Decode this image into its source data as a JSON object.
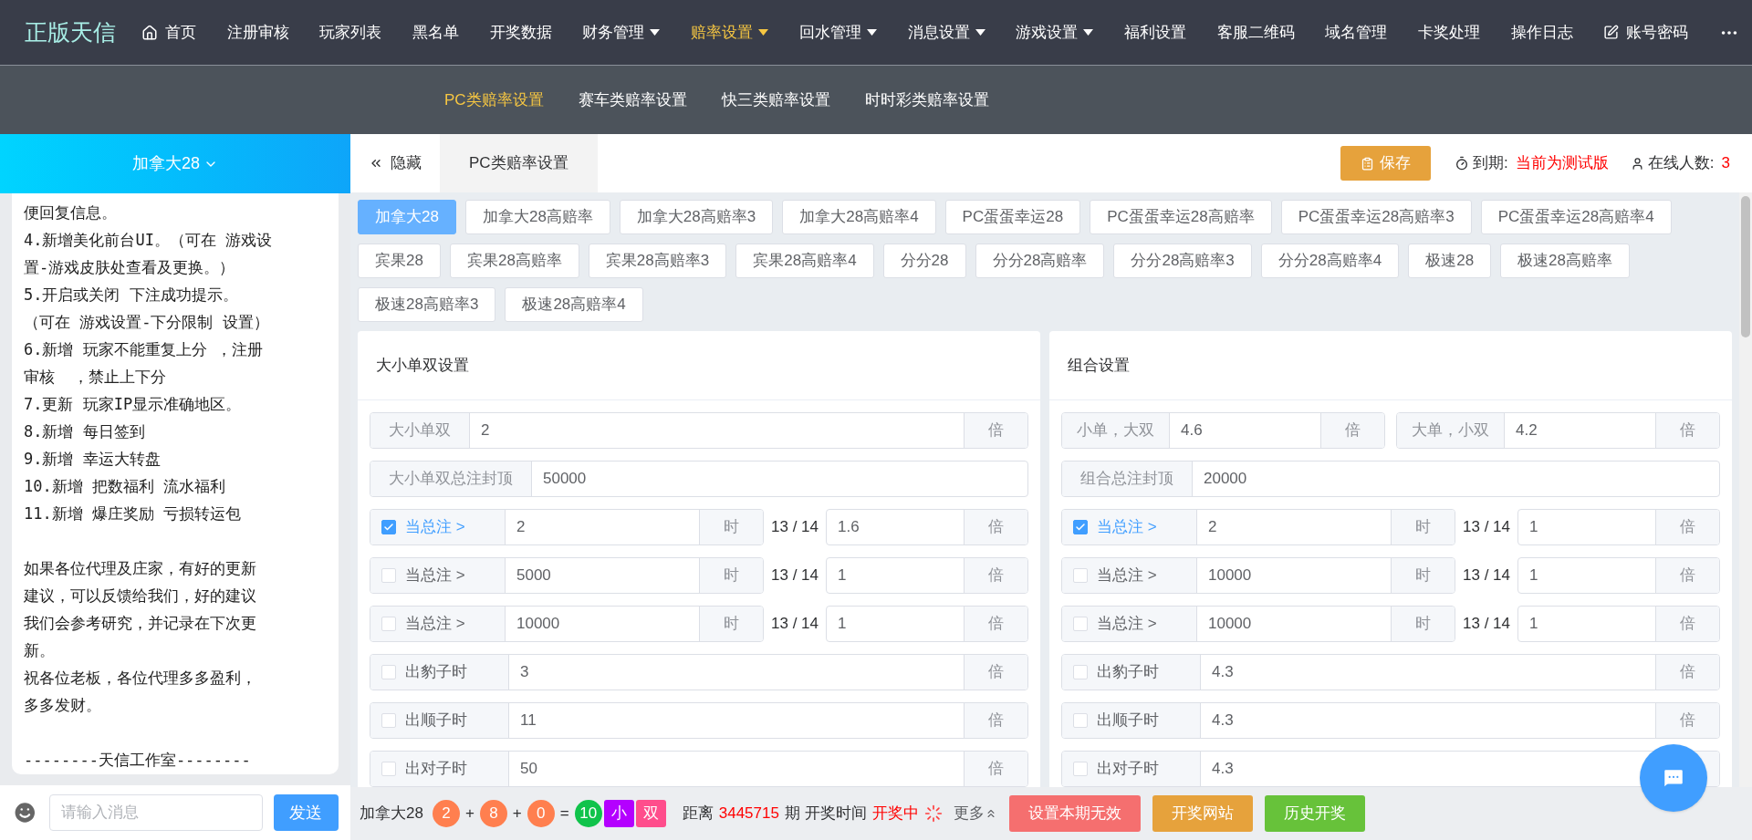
{
  "brand": "正版天信",
  "nav": [
    {
      "label": "首页",
      "dropdown": false,
      "selected": false
    },
    {
      "label": "注册审核",
      "dropdown": false,
      "selected": false
    },
    {
      "label": "玩家列表",
      "dropdown": false,
      "selected": false
    },
    {
      "label": "黑名单",
      "dropdown": false,
      "selected": false
    },
    {
      "label": "开奖数据",
      "dropdown": false,
      "selected": false
    },
    {
      "label": "财务管理",
      "dropdown": true,
      "selected": false
    },
    {
      "label": "赔率设置",
      "dropdown": true,
      "selected": true
    },
    {
      "label": "回水管理",
      "dropdown": true,
      "selected": false
    },
    {
      "label": "消息设置",
      "dropdown": true,
      "selected": false
    },
    {
      "label": "游戏设置",
      "dropdown": true,
      "selected": false
    },
    {
      "label": "福利设置",
      "dropdown": false,
      "selected": false
    },
    {
      "label": "客服二维码",
      "dropdown": false,
      "selected": false
    },
    {
      "label": "域名管理",
      "dropdown": false,
      "selected": false
    },
    {
      "label": "卡奖处理",
      "dropdown": false,
      "selected": false
    },
    {
      "label": "操作日志",
      "dropdown": false,
      "selected": false
    },
    {
      "label": "账号密码",
      "dropdown": false,
      "selected": false
    }
  ],
  "subnav": [
    {
      "label": "PC类赔率设置",
      "selected": true
    },
    {
      "label": "赛车类赔率设置",
      "selected": false
    },
    {
      "label": "快三类赔率设置",
      "selected": false
    },
    {
      "label": "时时彩类赔率设置",
      "selected": false
    }
  ],
  "sidebar": {
    "title": "加拿大28",
    "notes": [
      [
        "便回复信息。",
        "4.新增美化前台UI。（可在 游戏设",
        "置-游戏皮肤处查看及更换。）",
        "5.开启或关闭 下注成功提示。",
        "（可在 游戏设置-下分限制 设置）",
        "6.新增 玩家不能重复上分 ，注册",
        "审核  ，禁止上下分",
        "7.更新 玩家IP显示准确地区。",
        "8.新增 每日签到",
        "9.新增 幸运大转盘",
        "10.新增 把数福利 流水福利",
        "11.新增 爆庄奖励 亏损转运包"
      ],
      [
        "如果各位代理及庄家，有好的更新",
        "建议，可以反馈给我们，好的建议",
        "我们会参考研究，并记录在下次更",
        "新。",
        "祝各位老板，各位代理多多盈利，",
        "多多发财。"
      ],
      [
        "--------天信工作室--------"
      ]
    ],
    "chat": {
      "placeholder": "请输入消息",
      "send": "发送"
    }
  },
  "header": {
    "hide": "隐藏",
    "tab": "PC类赔率设置",
    "save": "保存",
    "expiry_label": "到期:",
    "expiry_value": "当前为测试版",
    "online_label": "在线人数:",
    "online_value": "3"
  },
  "games": [
    {
      "label": "加拿大28",
      "selected": true
    },
    {
      "label": "加拿大28高赔率",
      "selected": false
    },
    {
      "label": "加拿大28高赔率3",
      "selected": false
    },
    {
      "label": "加拿大28高赔率4",
      "selected": false
    },
    {
      "label": "PC蛋蛋幸运28",
      "selected": false
    },
    {
      "label": "PC蛋蛋幸运28高赔率",
      "selected": false
    },
    {
      "label": "PC蛋蛋幸运28高赔率3",
      "selected": false
    },
    {
      "label": "PC蛋蛋幸运28高赔率4",
      "selected": false
    },
    {
      "label": "宾果28",
      "selected": false
    },
    {
      "label": "宾果28高赔率",
      "selected": false
    },
    {
      "label": "宾果28高赔率3",
      "selected": false
    },
    {
      "label": "宾果28高赔率4",
      "selected": false
    },
    {
      "label": "分分28",
      "selected": false
    },
    {
      "label": "分分28高赔率",
      "selected": false
    },
    {
      "label": "分分28高赔率3",
      "selected": false
    },
    {
      "label": "分分28高赔率4",
      "selected": false
    },
    {
      "label": "极速28",
      "selected": false
    },
    {
      "label": "极速28高赔率",
      "selected": false
    },
    {
      "label": "极速28高赔率3",
      "selected": false
    },
    {
      "label": "极速28高赔率4",
      "selected": false
    }
  ],
  "panels": [
    {
      "title": "大小单双设置",
      "rows": [
        {
          "kind": "field",
          "label": "大小单双",
          "value": "2",
          "unit": "倍"
        },
        {
          "kind": "field",
          "label": "大小单双总注封顶",
          "value": "50000"
        },
        {
          "kind": "threshold",
          "checked": true,
          "label": "当总注 >",
          "value": "2",
          "unit": "时",
          "ratio": "13 / 14",
          "value2": "1.6",
          "unit2": "倍"
        },
        {
          "kind": "threshold",
          "checked": false,
          "label": "当总注 >",
          "value": "5000",
          "unit": "时",
          "ratio": "13 / 14",
          "value2": "1",
          "unit2": "倍"
        },
        {
          "kind": "threshold",
          "checked": false,
          "label": "当总注 >",
          "value": "10000",
          "unit": "时",
          "ratio": "13 / 14",
          "value2": "1",
          "unit2": "倍"
        },
        {
          "kind": "check",
          "checked": false,
          "label": "出豹子时",
          "value": "3",
          "unit": "倍"
        },
        {
          "kind": "check",
          "checked": false,
          "label": "出顺子时",
          "value": "11",
          "unit": "倍"
        },
        {
          "kind": "check",
          "checked": false,
          "label": "出对子时",
          "value": "50",
          "unit": "倍"
        }
      ]
    },
    {
      "title": "组合设置",
      "rows": [
        {
          "kind": "pair",
          "items": [
            {
              "label": "小单，大双",
              "value": "4.6",
              "unit": "倍"
            },
            {
              "label": "大单，小双",
              "value": "4.2",
              "unit": "倍"
            }
          ]
        },
        {
          "kind": "field",
          "label": "组合总注封顶",
          "value": "20000"
        },
        {
          "kind": "threshold",
          "checked": true,
          "label": "当总注 >",
          "value": "2",
          "unit": "时",
          "ratio": "13 / 14",
          "value2": "1",
          "unit2": "倍"
        },
        {
          "kind": "threshold",
          "checked": false,
          "label": "当总注 >",
          "value": "10000",
          "unit": "时",
          "ratio": "13 / 14",
          "value2": "1",
          "unit2": "倍"
        },
        {
          "kind": "threshold",
          "checked": false,
          "label": "当总注 >",
          "value": "10000",
          "unit": "时",
          "ratio": "13 / 14",
          "value2": "1",
          "unit2": "倍"
        },
        {
          "kind": "check",
          "checked": false,
          "label": "出豹子时",
          "value": "4.3",
          "unit": "倍"
        },
        {
          "kind": "check",
          "checked": false,
          "label": "出顺子时",
          "value": "4.3",
          "unit": "倍"
        },
        {
          "kind": "check",
          "checked": false,
          "label": "出对子时",
          "value": "4.3"
        }
      ]
    }
  ],
  "footer": {
    "game": "加拿大28",
    "draw": [
      {
        "kind": "ball",
        "text": "2",
        "color": "#ff7f4f"
      },
      {
        "kind": "op",
        "text": "+"
      },
      {
        "kind": "ball",
        "text": "8",
        "color": "#ff7f4f"
      },
      {
        "kind": "op",
        "text": "+"
      },
      {
        "kind": "ball",
        "text": "0",
        "color": "#ff7f4f"
      },
      {
        "kind": "op",
        "text": "="
      },
      {
        "kind": "ball",
        "text": "10",
        "color": "#10c34b"
      },
      {
        "kind": "tag",
        "text": "小",
        "color": "#b400ff"
      },
      {
        "kind": "tag",
        "text": "双",
        "color": "#ff4d8c"
      }
    ],
    "distance": "距离",
    "period": "3445715",
    "period_suffix": "期 开奖时间",
    "status": "开奖中",
    "more": "更多",
    "buttons": [
      {
        "label": "设置本期无效",
        "color": "#f56f6f"
      },
      {
        "label": "开奖网站",
        "color": "#e6a23c"
      },
      {
        "label": "历史开奖",
        "color": "#67c23a"
      }
    ]
  }
}
